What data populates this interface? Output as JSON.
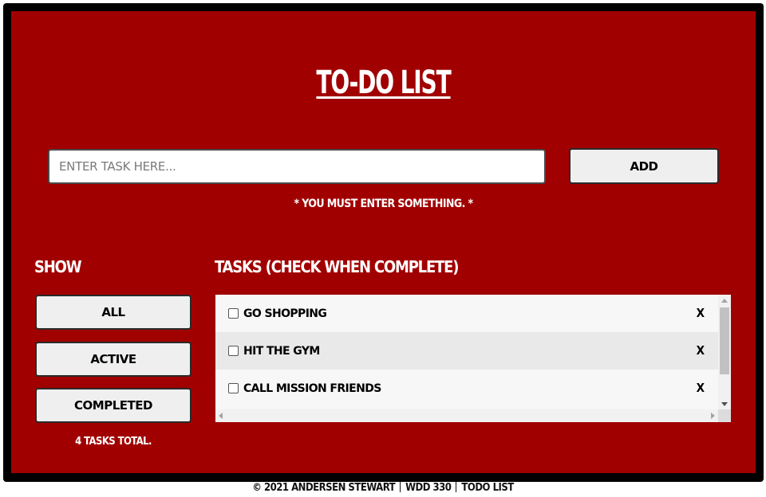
{
  "app": {
    "title": "TO-DO LIST"
  },
  "entry": {
    "placeholder": "ENTER TASK HERE...",
    "value": "",
    "add_label": "ADD",
    "warning": "* YOU MUST ENTER SOMETHING. *"
  },
  "filters": {
    "heading": "SHOW",
    "all_label": "ALL",
    "active_label": "ACTIVE",
    "completed_label": "COMPLETED",
    "count_text": "4 TASKS TOTAL."
  },
  "tasks": {
    "heading": "TASKS (CHECK WHEN COMPLETE)",
    "delete_label": "X",
    "items": [
      {
        "label": "GO SHOPPING",
        "checked": false
      },
      {
        "label": "HIT THE GYM",
        "checked": false
      },
      {
        "label": "CALL MISSION FRIENDS",
        "checked": false
      }
    ]
  },
  "footer": {
    "copyright": "© 2021 ANDERSEN STEWART",
    "course": "WDD 330",
    "project": "TODO LIST"
  },
  "colors": {
    "panel": "#a10000",
    "frame": "#000000",
    "button": "#efefef"
  }
}
